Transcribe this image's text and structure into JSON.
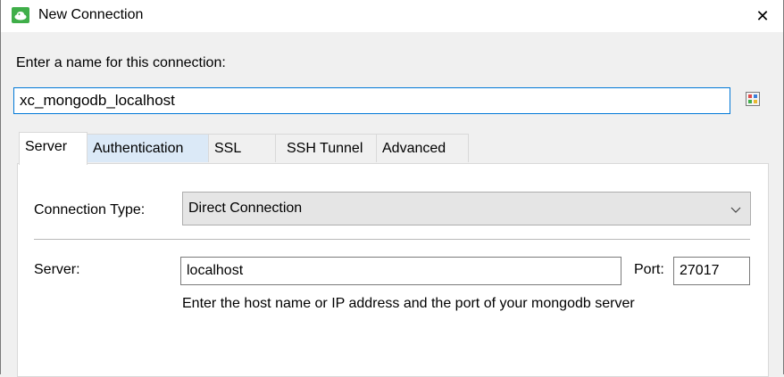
{
  "window": {
    "title": "New Connection",
    "close_glyph": "✕",
    "accent": "#0078d7"
  },
  "connection_name": {
    "label": "Enter a name for this connection:",
    "value": "xc_mongodb_localhost"
  },
  "tabs": [
    {
      "label": "Server",
      "active": true
    },
    {
      "label": "Authentication",
      "hovered": true
    },
    {
      "label": "SSL"
    },
    {
      "label": "SSH Tunnel"
    },
    {
      "label": "Advanced"
    }
  ],
  "server_tab": {
    "connection_type_label": "Connection Type:",
    "connection_type_value": "Direct Connection",
    "server_label": "Server:",
    "server_value": "localhost",
    "port_label": "Port:",
    "port_value": "27017",
    "hint": "Enter the host name or IP address and the port of your mongodb server"
  },
  "icons": {
    "app": "mongo-leaf-app-icon",
    "color_picker": "color-palette-icon",
    "dropdown": "chevron-down-icon"
  }
}
